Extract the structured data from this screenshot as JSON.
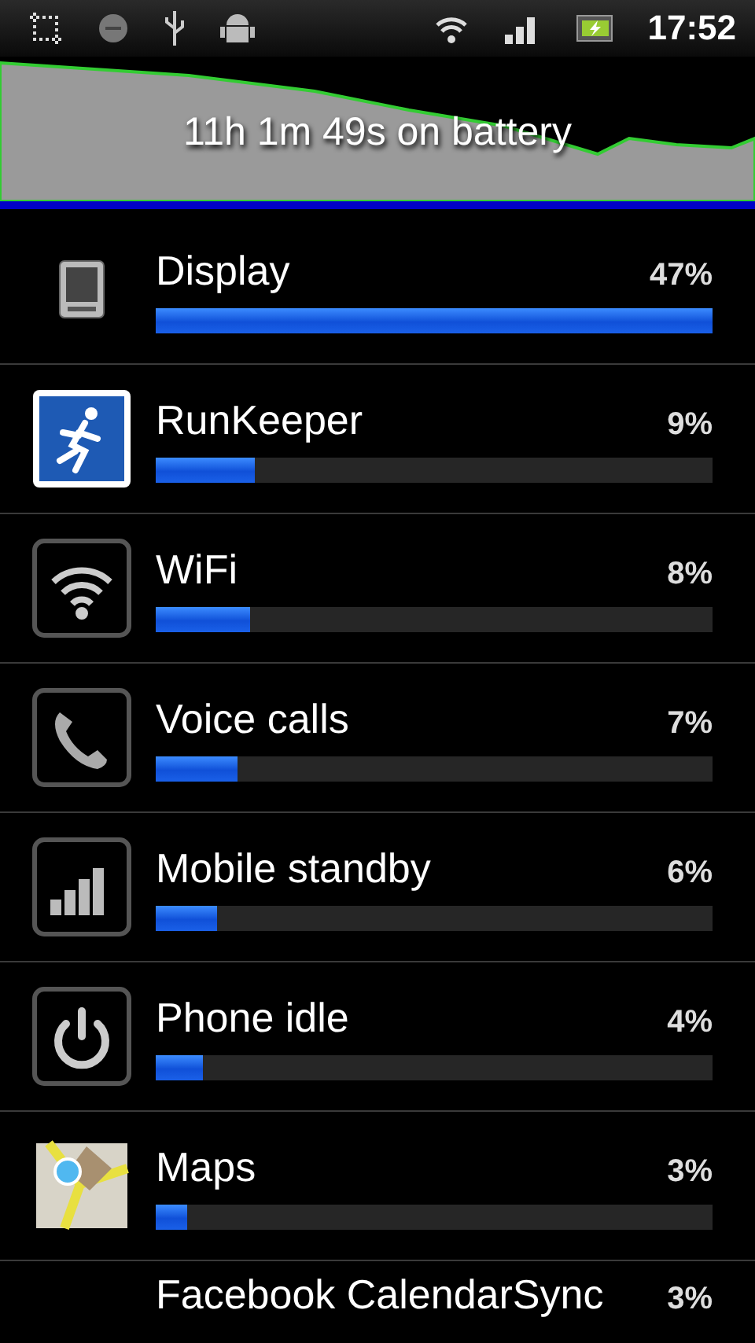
{
  "status_bar": {
    "time": "17:52"
  },
  "graph": {
    "caption": "11h 1m 49s on battery"
  },
  "items": [
    {
      "kind": "display",
      "name": "Display",
      "percent": "47%",
      "level": 1.0
    },
    {
      "kind": "runner",
      "name": "RunKeeper",
      "percent": "9%",
      "level": 0.178
    },
    {
      "kind": "wifi",
      "name": "WiFi",
      "percent": "8%",
      "level": 0.17
    },
    {
      "kind": "phone",
      "name": "Voice calls",
      "percent": "7%",
      "level": 0.147
    },
    {
      "kind": "signal",
      "name": "Mobile standby",
      "percent": "6%",
      "level": 0.11
    },
    {
      "kind": "power",
      "name": "Phone idle",
      "percent": "4%",
      "level": 0.085
    },
    {
      "kind": "map",
      "name": "Maps",
      "percent": "3%",
      "level": 0.056
    },
    {
      "kind": "none",
      "name": "Facebook CalendarSync",
      "percent": "3%"
    }
  ]
}
